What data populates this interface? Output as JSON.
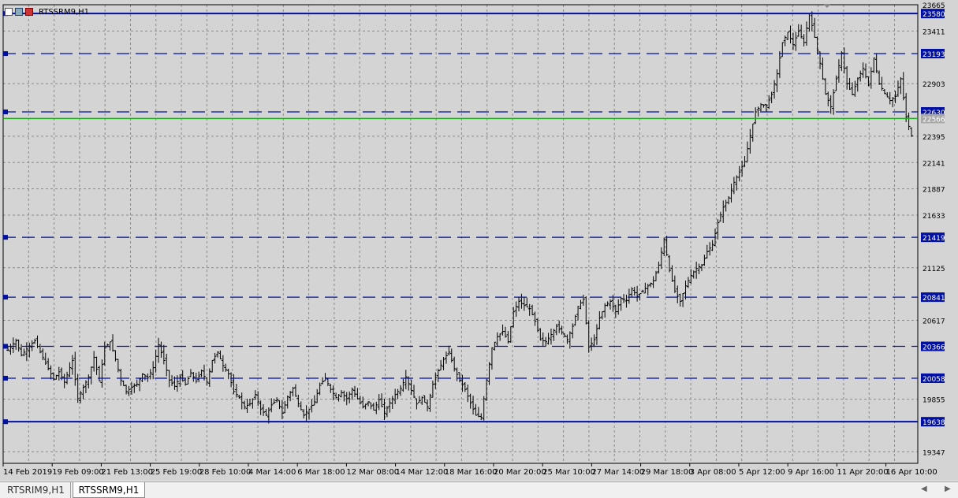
{
  "symbol": "RTSSRM9,H1",
  "tabs": [
    "RTSRIM9,H1",
    "RTSSRM9,H1"
  ],
  "active_tab": 1,
  "colors": {
    "background": "#d4d4d4",
    "grid": "#8a8a8a",
    "level": "#0010a0",
    "bid": "#22aa22",
    "candle": "#000000",
    "price_label_text": "#ffffff",
    "bid_label_bg": "#a8a8a8"
  },
  "chart_data": {
    "type": "candlestick",
    "title": "RTSSRM9,H1",
    "grid": true,
    "ylim": [
      19236,
      23665
    ],
    "y_ticks": [
      "23665",
      "23411",
      "22903",
      "22395",
      "22141",
      "21887",
      "21633",
      "21125",
      "20617",
      "19855",
      "19347"
    ],
    "x_ticks": [
      "14 Feb 2019",
      "19 Feb 09:00",
      "21 Feb 13:00",
      "25 Feb 19:00",
      "28 Feb 10:00",
      "4 Mar 14:00",
      "6 Mar 18:00",
      "12 Mar 08:00",
      "14 Mar 12:00",
      "18 Mar 16:00",
      "20 Mar 20:00",
      "25 Mar 10:00",
      "27 Mar 14:00",
      "29 Mar 18:00",
      "3 Apr 08:00",
      "5 Apr 12:00",
      "9 Apr 16:00",
      "11 Apr 20:00",
      "16 Apr 10:00"
    ],
    "levels": [
      {
        "value": 23580,
        "label": "23580",
        "style": "solid"
      },
      {
        "value": 23193,
        "label": "23193",
        "style": "dashed"
      },
      {
        "value": 22630,
        "label": "22630",
        "style": "dashed"
      },
      {
        "value": 21419,
        "label": "21419",
        "style": "dashed"
      },
      {
        "value": 20841,
        "label": "20841",
        "style": "dashed"
      },
      {
        "value": 20366,
        "label": "20366",
        "style": "dashed"
      },
      {
        "value": 20058,
        "label": "20058",
        "style": "dashed"
      },
      {
        "value": 19638,
        "label": "19638",
        "style": "solid"
      }
    ],
    "bid": {
      "value": 22566,
      "label": "22566"
    },
    "price_path": [
      [
        0,
        20330
      ],
      [
        3,
        20420
      ],
      [
        5,
        20280
      ],
      [
        8,
        20370
      ],
      [
        10,
        20420
      ],
      [
        12,
        20310
      ],
      [
        15,
        20150
      ],
      [
        17,
        20050
      ],
      [
        19,
        20120
      ],
      [
        21,
        20020
      ],
      [
        24,
        20230
      ],
      [
        26,
        19860
      ],
      [
        28,
        19970
      ],
      [
        30,
        20070
      ],
      [
        32,
        20260
      ],
      [
        34,
        20030
      ],
      [
        36,
        20350
      ],
      [
        38,
        20410
      ],
      [
        40,
        20240
      ],
      [
        42,
        20040
      ],
      [
        44,
        19930
      ],
      [
        46,
        19970
      ],
      [
        48,
        20000
      ],
      [
        50,
        20100
      ],
      [
        52,
        20060
      ],
      [
        54,
        20160
      ],
      [
        56,
        20380
      ],
      [
        58,
        20230
      ],
      [
        60,
        20040
      ],
      [
        62,
        19980
      ],
      [
        64,
        20070
      ],
      [
        66,
        20000
      ],
      [
        68,
        20110
      ],
      [
        70,
        20030
      ],
      [
        72,
        20130
      ],
      [
        74,
        20020
      ],
      [
        76,
        20230
      ],
      [
        78,
        20310
      ],
      [
        80,
        20180
      ],
      [
        82,
        20100
      ],
      [
        84,
        19930
      ],
      [
        86,
        19870
      ],
      [
        88,
        19780
      ],
      [
        90,
        19810
      ],
      [
        92,
        19900
      ],
      [
        94,
        19760
      ],
      [
        96,
        19700
      ],
      [
        98,
        19800
      ],
      [
        100,
        19850
      ],
      [
        102,
        19720
      ],
      [
        104,
        19880
      ],
      [
        106,
        19960
      ],
      [
        108,
        19810
      ],
      [
        110,
        19700
      ],
      [
        112,
        19760
      ],
      [
        114,
        19830
      ],
      [
        116,
        19990
      ],
      [
        118,
        20060
      ],
      [
        120,
        19950
      ],
      [
        122,
        19870
      ],
      [
        124,
        19920
      ],
      [
        126,
        19860
      ],
      [
        128,
        19950
      ],
      [
        130,
        19860
      ],
      [
        132,
        19780
      ],
      [
        134,
        19830
      ],
      [
        136,
        19750
      ],
      [
        138,
        19850
      ],
      [
        140,
        19720
      ],
      [
        142,
        19820
      ],
      [
        144,
        19900
      ],
      [
        146,
        19960
      ],
      [
        148,
        20070
      ],
      [
        150,
        19940
      ],
      [
        152,
        19810
      ],
      [
        154,
        19870
      ],
      [
        156,
        19780
      ],
      [
        158,
        20000
      ],
      [
        160,
        20130
      ],
      [
        162,
        20240
      ],
      [
        164,
        20310
      ],
      [
        166,
        20150
      ],
      [
        168,
        20040
      ],
      [
        170,
        19950
      ],
      [
        172,
        19820
      ],
      [
        174,
        19700
      ],
      [
        176,
        19680
      ],
      [
        178,
        20040
      ],
      [
        180,
        20350
      ],
      [
        182,
        20460
      ],
      [
        184,
        20510
      ],
      [
        186,
        20410
      ],
      [
        188,
        20700
      ],
      [
        190,
        20800
      ],
      [
        192,
        20760
      ],
      [
        194,
        20730
      ],
      [
        196,
        20610
      ],
      [
        198,
        20430
      ],
      [
        200,
        20410
      ],
      [
        202,
        20480
      ],
      [
        204,
        20560
      ],
      [
        206,
        20500
      ],
      [
        208,
        20430
      ],
      [
        210,
        20560
      ],
      [
        212,
        20750
      ],
      [
        214,
        20820
      ],
      [
        216,
        20360
      ],
      [
        218,
        20430
      ],
      [
        220,
        20640
      ],
      [
        222,
        20760
      ],
      [
        224,
        20800
      ],
      [
        226,
        20700
      ],
      [
        228,
        20830
      ],
      [
        230,
        20810
      ],
      [
        232,
        20920
      ],
      [
        234,
        20850
      ],
      [
        236,
        20900
      ],
      [
        238,
        20950
      ],
      [
        240,
        21000
      ],
      [
        242,
        21150
      ],
      [
        244,
        21400
      ],
      [
        246,
        21100
      ],
      [
        248,
        20900
      ],
      [
        250,
        20800
      ],
      [
        252,
        20950
      ],
      [
        254,
        21050
      ],
      [
        256,
        21120
      ],
      [
        258,
        21150
      ],
      [
        260,
        21280
      ],
      [
        262,
        21350
      ],
      [
        264,
        21560
      ],
      [
        266,
        21710
      ],
      [
        268,
        21800
      ],
      [
        270,
        21950
      ],
      [
        272,
        22050
      ],
      [
        274,
        22150
      ],
      [
        276,
        22400
      ],
      [
        278,
        22630
      ],
      [
        280,
        22700
      ],
      [
        282,
        22690
      ],
      [
        284,
        22800
      ],
      [
        286,
        23000
      ],
      [
        288,
        23300
      ],
      [
        290,
        23400
      ],
      [
        292,
        23280
      ],
      [
        294,
        23410
      ],
      [
        296,
        23300
      ],
      [
        298,
        23580
      ],
      [
        300,
        23350
      ],
      [
        302,
        23100
      ],
      [
        304,
        22800
      ],
      [
        306,
        22680
      ],
      [
        308,
        22950
      ],
      [
        310,
        23200
      ],
      [
        312,
        22900
      ],
      [
        314,
        22800
      ],
      [
        316,
        22950
      ],
      [
        318,
        23050
      ],
      [
        320,
        22890
      ],
      [
        322,
        23150
      ],
      [
        324,
        22900
      ],
      [
        326,
        22810
      ],
      [
        328,
        22740
      ],
      [
        330,
        22780
      ],
      [
        332,
        22950
      ],
      [
        334,
        22580
      ],
      [
        336,
        22400
      ]
    ]
  }
}
